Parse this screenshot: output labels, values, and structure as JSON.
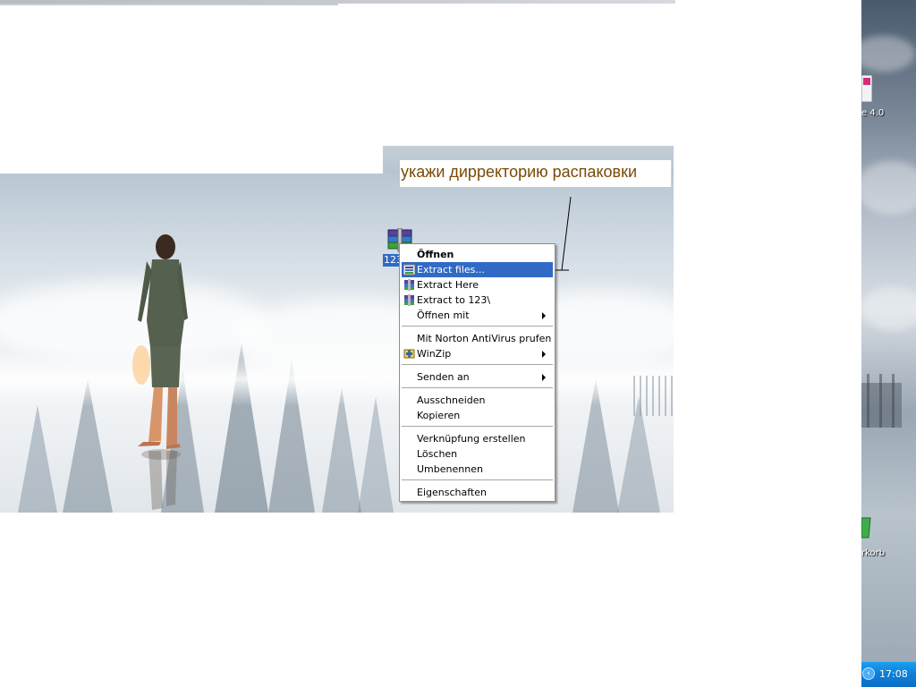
{
  "callout": {
    "text": "укажи дирректорию распаковки"
  },
  "desktop": {
    "archive_icon": {
      "label": "123",
      "icon": "winrar-archive-icon"
    },
    "strip_icons": [
      {
        "label": "e 4.0",
        "icon": "shortcut-icon"
      },
      {
        "label": "rkorb",
        "icon": "recycle-bin-icon"
      }
    ]
  },
  "taskbar": {
    "clock": "17:08",
    "tray_toggle_icon": "chevron-left-icon"
  },
  "context_menu": {
    "items": [
      {
        "label": "Öffnen",
        "bold": true,
        "icon": null,
        "submenu": false
      },
      {
        "label": "Extract files...",
        "bold": false,
        "icon": "winrar-extract-icon",
        "submenu": false,
        "highlighted": true
      },
      {
        "label": "Extract Here",
        "bold": false,
        "icon": "winrar-icon",
        "submenu": false
      },
      {
        "label": "Extract to 123\\",
        "bold": false,
        "icon": "winrar-icon",
        "submenu": false
      },
      {
        "label": "Öffnen mit",
        "bold": false,
        "icon": null,
        "submenu": true
      },
      {
        "label": "Mit Norton AntiVirus prufen",
        "bold": false,
        "icon": null,
        "submenu": false
      },
      {
        "label": "WinZip",
        "bold": false,
        "icon": "winzip-icon",
        "submenu": true
      },
      {
        "label": "Senden an",
        "bold": false,
        "icon": null,
        "submenu": true
      },
      {
        "label": "Ausschneiden",
        "bold": false,
        "icon": null,
        "submenu": false
      },
      {
        "label": "Kopieren",
        "bold": false,
        "icon": null,
        "submenu": false
      },
      {
        "label": "Verknüpfung erstellen",
        "bold": false,
        "icon": null,
        "submenu": false
      },
      {
        "label": "Löschen",
        "bold": false,
        "icon": null,
        "submenu": false
      },
      {
        "label": "Umbenennen",
        "bold": false,
        "icon": null,
        "submenu": false
      },
      {
        "label": "Eigenschaften",
        "bold": false,
        "icon": null,
        "submenu": false
      }
    ]
  },
  "colors": {
    "selection": "#316ac5",
    "callout_text": "#7a4a04",
    "taskbar": "#0e7ed8"
  }
}
